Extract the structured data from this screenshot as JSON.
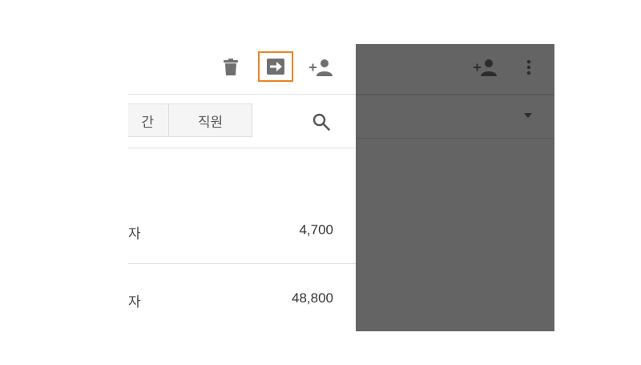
{
  "toolbar": {
    "icons": [
      "trash-icon",
      "export-arrow-icon",
      "add-user-icon"
    ],
    "highlight_color": "#f08320"
  },
  "filters": {
    "segments": [
      "간",
      "직원"
    ],
    "search_icon": "search-icon"
  },
  "rows": [
    {
      "label": "자",
      "value": "4,700"
    },
    {
      "label": "자",
      "value": "48,800"
    }
  ],
  "overlay_panel": {
    "background": "#646464",
    "icons": [
      "add-user-icon",
      "more-vert-icon",
      "dropdown-caret-icon"
    ]
  }
}
